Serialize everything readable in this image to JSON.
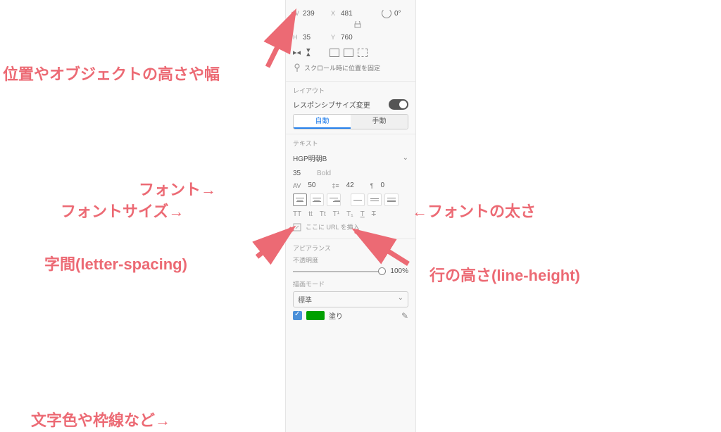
{
  "annotations": {
    "pos_size": "位置やオブジェクトの高さや幅",
    "font": "フォント→",
    "font_size": "フォントサイズ→",
    "font_weight": "←フォントの太さ",
    "letter_spacing": "字間(letter-spacing)",
    "line_height": "行の高さ(line-height)",
    "color_border": "文字色や枠線など→"
  },
  "transform": {
    "w_label": "W",
    "w": "239",
    "x_label": "X",
    "x": "481",
    "rot": "0°",
    "h_label": "H",
    "h": "35",
    "y_label": "Y",
    "y": "760",
    "scroll_fix": "スクロール時に位置を固定"
  },
  "layout": {
    "title": "レイアウト",
    "responsive_label": "レスポンシブサイズ変更",
    "seg_auto": "自動",
    "seg_manual": "手動"
  },
  "text": {
    "title": "テキスト",
    "font_family": "HGP明朝B",
    "font_size": "35",
    "font_weight": "Bold",
    "letter_spacing": "50",
    "line_height": "42",
    "para_spacing": "0",
    "case_TT": "TT",
    "case_tt": "tt",
    "case_Tt": "Tt",
    "sup": "T¹",
    "sub": "T₁",
    "underline": "T",
    "strike": "T",
    "url_placeholder": "ここに URL を挿入"
  },
  "appearance": {
    "title": "アピアランス",
    "opacity_label": "不透明度",
    "opacity_value": "100%",
    "blend_label": "描画モード",
    "blend_value": "標準",
    "fill_label": "塗り"
  }
}
